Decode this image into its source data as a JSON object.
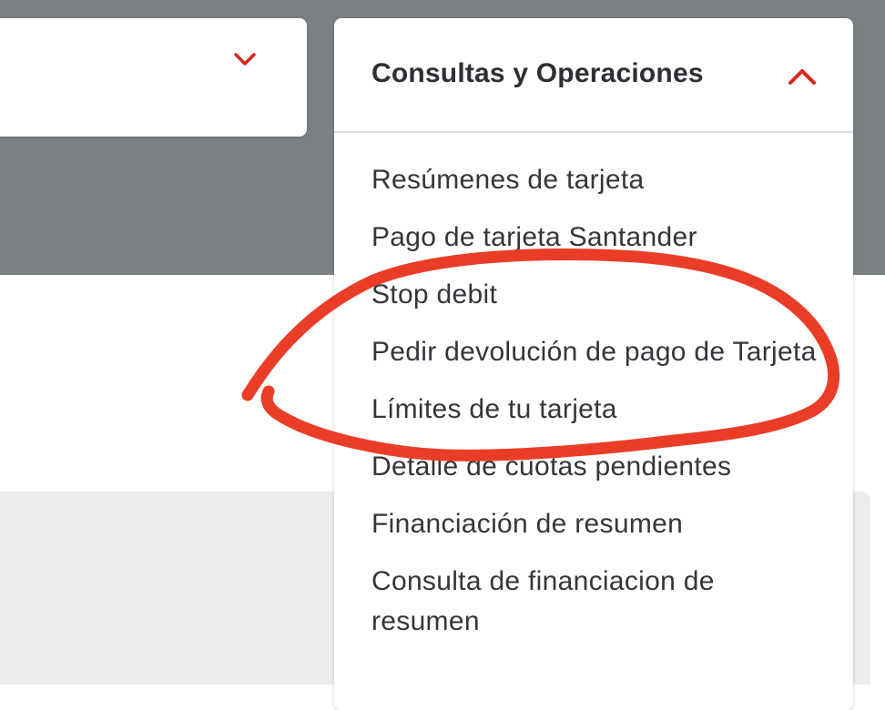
{
  "colors": {
    "accent": "#d9261c",
    "annotation": "#ea3d28",
    "header_band": "#7a8084"
  },
  "left_card": {
    "icon": "chevron-down-icon"
  },
  "menu": {
    "title": "Consultas y Operaciones",
    "toggle_icon": "chevron-up-icon",
    "items": [
      {
        "label": "Resúmenes de tarjeta"
      },
      {
        "label": "Pago de tarjeta Santander"
      },
      {
        "label": "Stop debit"
      },
      {
        "label": "Pedir devolución de pago de Tarjeta"
      },
      {
        "label": "Límites de tu tarjeta"
      },
      {
        "label": "Detalle de cuotas pendientes"
      },
      {
        "label": "Financiación de resumen"
      },
      {
        "label": "Consulta de financiacion de resumen"
      }
    ]
  },
  "annotation": {
    "shape": "hand-drawn-circle",
    "target": "Pedir devolución de pago de Tarjeta"
  }
}
